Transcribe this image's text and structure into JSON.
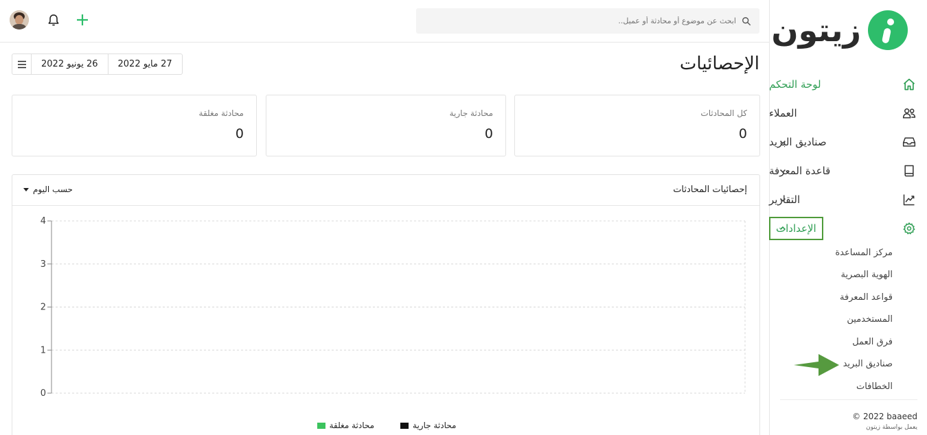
{
  "brand": {
    "logo_text": "زيتون"
  },
  "search": {
    "placeholder": "ابحث عن موضوع أو محادثة أو عميل.."
  },
  "nav": {
    "items": [
      {
        "label": "لوحة التحكم",
        "icon": "home-icon",
        "active": true
      },
      {
        "label": "العملاء",
        "icon": "users-icon"
      },
      {
        "label": "صناديق البريد",
        "icon": "inbox-icon",
        "expandable": true
      },
      {
        "label": "قاعدة المعرفة",
        "icon": "book-icon",
        "expandable": true
      },
      {
        "label": "التقارير",
        "icon": "chart-line-icon",
        "expandable": true
      },
      {
        "label": "الإعدادات",
        "icon": "gear-icon",
        "expandable": true,
        "expanded": true
      }
    ],
    "settings_sub": [
      "مركز المساعدة",
      "الهوية البصرية",
      "قواعد المعرفة",
      "المستخدمين",
      "فرق العمل",
      "صناديق البريد",
      "الخطافات"
    ]
  },
  "footer": {
    "copyright": "© 2022 baaeed",
    "powered": "يعمل بواسطة زيتون"
  },
  "page": {
    "title": "الإحصائيات"
  },
  "date_range": {
    "from": "27 مايو 2022",
    "to": "26 يونيو 2022"
  },
  "stats": [
    {
      "label": "كل المحادثات",
      "value": "0"
    },
    {
      "label": "محادثة جارية",
      "value": "0"
    },
    {
      "label": "محادثة مغلقة",
      "value": "0"
    }
  ],
  "chart_card": {
    "title": "إحصائيات المحادثات",
    "period": "حسب اليوم"
  },
  "colors": {
    "accent": "#2ebd6b",
    "highlight": "#4e9b3a",
    "ongoing": "#111111",
    "closed": "#3cc35e"
  },
  "chart_data": {
    "type": "line",
    "title": "",
    "x": [],
    "ylim": [
      0,
      4
    ],
    "yticks": [
      0,
      1,
      2,
      3,
      4
    ],
    "ytick_labels": [
      "0",
      "1",
      "2",
      "3",
      "4"
    ],
    "grid": true,
    "legend_position": "bottom",
    "series": [
      {
        "name": "محادثة جارية",
        "color": "#111111",
        "values": []
      },
      {
        "name": "محادثة مغلقة",
        "color": "#3cc35e",
        "values": []
      }
    ]
  }
}
